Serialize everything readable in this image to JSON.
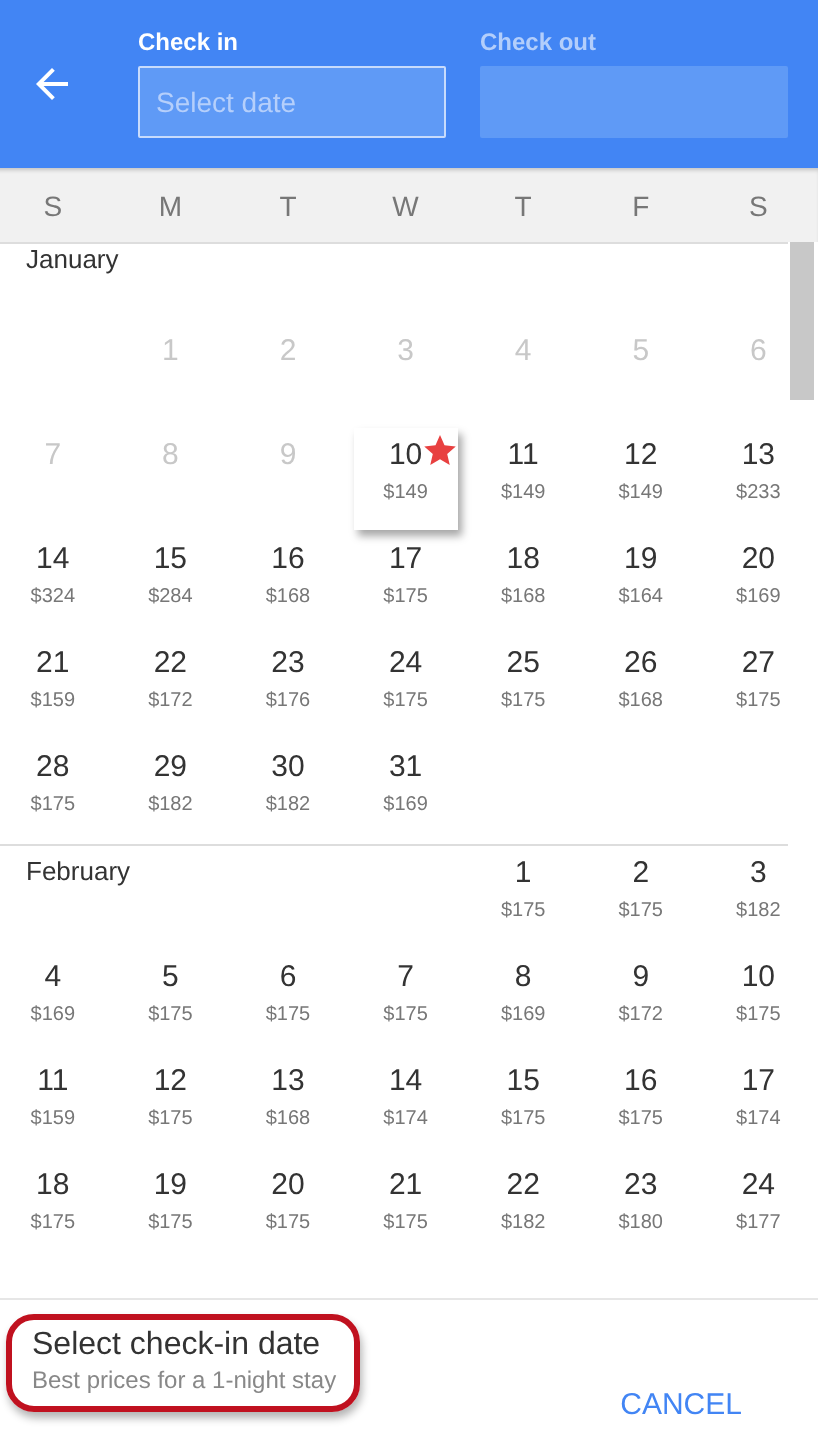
{
  "header": {
    "back_button": true,
    "check_in": {
      "label": "Check in",
      "placeholder": "Select date",
      "active": true
    },
    "check_out": {
      "label": "Check out",
      "active": false
    }
  },
  "weekdays": [
    "S",
    "M",
    "T",
    "W",
    "T",
    "F",
    "S"
  ],
  "months": [
    {
      "name": "January",
      "weeks": [
        [
          {
            "day": "1",
            "disabled": true,
            "best_deal": false
          },
          {
            "day": "2",
            "disabled": true,
            "best_deal": false
          },
          {
            "day": "3",
            "disabled": true,
            "best_deal": false
          },
          {
            "day": "4",
            "disabled": true,
            "best_deal": false
          },
          {
            "day": "5",
            "disabled": true,
            "best_deal": false
          },
          {
            "day": "6",
            "disabled": true,
            "best_deal": false
          }
        ],
        [
          {
            "day": "7",
            "disabled": true,
            "best_deal": false
          },
          {
            "day": "8",
            "disabled": true,
            "best_deal": false
          },
          {
            "day": "9",
            "disabled": true,
            "best_deal": false
          },
          {
            "day": "10",
            "price": "$149",
            "disabled": false,
            "best_deal": true
          },
          {
            "day": "11",
            "price": "$149",
            "disabled": false,
            "best_deal": false
          },
          {
            "day": "12",
            "price": "$149",
            "disabled": false,
            "best_deal": false
          },
          {
            "day": "13",
            "price": "$233",
            "disabled": false,
            "best_deal": false
          }
        ],
        [
          {
            "day": "14",
            "price": "$324",
            "disabled": false,
            "best_deal": false
          },
          {
            "day": "15",
            "price": "$284",
            "disabled": false,
            "best_deal": false
          },
          {
            "day": "16",
            "price": "$168",
            "disabled": false,
            "best_deal": false
          },
          {
            "day": "17",
            "price": "$175",
            "disabled": false,
            "best_deal": false
          },
          {
            "day": "18",
            "price": "$168",
            "disabled": false,
            "best_deal": false
          },
          {
            "day": "19",
            "price": "$164",
            "disabled": false,
            "best_deal": false
          },
          {
            "day": "20",
            "price": "$169",
            "disabled": false,
            "best_deal": false
          }
        ],
        [
          {
            "day": "21",
            "price": "$159",
            "disabled": false,
            "best_deal": false
          },
          {
            "day": "22",
            "price": "$172",
            "disabled": false,
            "best_deal": false
          },
          {
            "day": "23",
            "price": "$176",
            "disabled": false,
            "best_deal": false
          },
          {
            "day": "24",
            "price": "$175",
            "disabled": false,
            "best_deal": false
          },
          {
            "day": "25",
            "price": "$175",
            "disabled": false,
            "best_deal": false
          },
          {
            "day": "26",
            "price": "$168",
            "disabled": false,
            "best_deal": false
          },
          {
            "day": "27",
            "price": "$175",
            "disabled": false,
            "best_deal": false
          }
        ],
        [
          {
            "day": "28",
            "price": "$175",
            "disabled": false,
            "best_deal": false
          },
          {
            "day": "29",
            "price": "$182",
            "disabled": false,
            "best_deal": false
          },
          {
            "day": "30",
            "price": "$182",
            "disabled": false,
            "best_deal": false
          },
          {
            "day": "31",
            "price": "$169",
            "disabled": false,
            "best_deal": false
          }
        ]
      ]
    },
    {
      "name": "February",
      "weeks": [
        [
          {
            "day": "1",
            "price": "$175",
            "disabled": false,
            "best_deal": false
          },
          {
            "day": "2",
            "price": "$175",
            "disabled": false,
            "best_deal": false
          },
          {
            "day": "3",
            "price": "$182",
            "disabled": false,
            "best_deal": false
          }
        ],
        [
          {
            "day": "4",
            "price": "$169",
            "disabled": false,
            "best_deal": false
          },
          {
            "day": "5",
            "price": "$175",
            "disabled": false,
            "best_deal": false
          },
          {
            "day": "6",
            "price": "$175",
            "disabled": false,
            "best_deal": false
          },
          {
            "day": "7",
            "price": "$175",
            "disabled": false,
            "best_deal": false
          },
          {
            "day": "8",
            "price": "$169",
            "disabled": false,
            "best_deal": false
          },
          {
            "day": "9",
            "price": "$172",
            "disabled": false,
            "best_deal": false
          },
          {
            "day": "10",
            "price": "$175",
            "disabled": false,
            "best_deal": false
          }
        ],
        [
          {
            "day": "11",
            "price": "$159",
            "disabled": false,
            "best_deal": false
          },
          {
            "day": "12",
            "price": "$175",
            "disabled": false,
            "best_deal": false
          },
          {
            "day": "13",
            "price": "$168",
            "disabled": false,
            "best_deal": false
          },
          {
            "day": "14",
            "price": "$174",
            "disabled": false,
            "best_deal": false
          },
          {
            "day": "15",
            "price": "$175",
            "disabled": false,
            "best_deal": false
          },
          {
            "day": "16",
            "price": "$175",
            "disabled": false,
            "best_deal": false
          },
          {
            "day": "17",
            "price": "$174",
            "disabled": false,
            "best_deal": false
          }
        ],
        [
          {
            "day": "18",
            "price": "$175",
            "disabled": false,
            "best_deal": false
          },
          {
            "day": "19",
            "price": "$175",
            "disabled": false,
            "best_deal": false
          },
          {
            "day": "20",
            "price": "$175",
            "disabled": false,
            "best_deal": false
          },
          {
            "day": "21",
            "price": "$175",
            "disabled": false,
            "best_deal": false
          },
          {
            "day": "22",
            "price": "$182",
            "disabled": false,
            "best_deal": false
          },
          {
            "day": "23",
            "price": "$180",
            "disabled": false,
            "best_deal": false
          },
          {
            "day": "24",
            "price": "$177",
            "disabled": false,
            "best_deal": false
          }
        ]
      ]
    }
  ],
  "footer": {
    "title": "Select check-in date",
    "subtitle": "Best prices for a 1-night stay",
    "highlighted": true,
    "cancel_button": "CANCEL"
  }
}
